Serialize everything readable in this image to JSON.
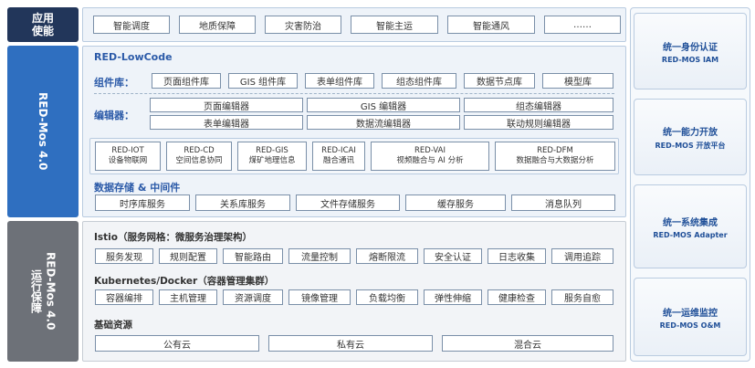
{
  "left_labels": {
    "app": "应用\n使能",
    "platform": "RED-Mos 4.0",
    "ops_cn": "运行保障",
    "ops_en": "RED-Mos 4.0"
  },
  "app_row": [
    "智能调度",
    "地质保障",
    "灾害防治",
    "智能主运",
    "智能通风",
    "……"
  ],
  "lowcode": {
    "title": "RED-LowCode",
    "components_label": "组件库：",
    "components": [
      "页面组件库",
      "GIS 组件库",
      "表单组件库",
      "组态组件库",
      "数据节点库",
      "模型库"
    ],
    "editors_label": "编辑器：",
    "editors_row1": [
      "页面编辑器",
      "GIS 编辑器",
      "组态编辑器"
    ],
    "editors_row2": [
      "表单编辑器",
      "数据流编辑器",
      "联动规则编辑器"
    ]
  },
  "modules": [
    {
      "name": "RED-IOT",
      "desc": "设备物联网"
    },
    {
      "name": "RED-CD",
      "desc": "空间信息协同"
    },
    {
      "name": "RED-GIS",
      "desc": "煤矿地理信息"
    },
    {
      "name": "RED-ICAI",
      "desc": "融合通讯"
    },
    {
      "name": "RED-VAI",
      "desc": "视频融合与 AI 分析"
    },
    {
      "name": "RED-DFM",
      "desc": "数据融合与大数据分析"
    }
  ],
  "storage": {
    "title": "数据存储 & 中间件",
    "items": [
      "时序库服务",
      "关系库服务",
      "文件存储服务",
      "缓存服务",
      "消息队列"
    ]
  },
  "istio": {
    "title": "Istio（服务网格：微服务治理架构）",
    "items": [
      "服务发现",
      "规则配置",
      "智能路由",
      "流量控制",
      "熔断限流",
      "安全认证",
      "日志收集",
      "调用追踪"
    ]
  },
  "k8s": {
    "title": "Kubernetes/Docker（容器管理集群）",
    "items": [
      "容器编排",
      "主机管理",
      "资源调度",
      "镜像管理",
      "负载均衡",
      "弹性伸缩",
      "健康检查",
      "服务自愈"
    ]
  },
  "infra": {
    "title": "基础资源",
    "items": [
      "公有云",
      "私有云",
      "混合云"
    ]
  },
  "right_cards": [
    {
      "title": "统一身份认证",
      "sub": "RED-MOS IAM"
    },
    {
      "title": "统一能力开放",
      "sub": "RED-MOS 开放平台"
    },
    {
      "title": "统一系统集成",
      "sub": "RED-MOS Adapter"
    },
    {
      "title": "统一运维监控",
      "sub": "RED-MOS O&M"
    }
  ],
  "colors": {
    "dark_navy": "#22365a",
    "blue": "#2f6fc0",
    "grey": "#6d7178",
    "title_blue": "#2b5aa8"
  }
}
